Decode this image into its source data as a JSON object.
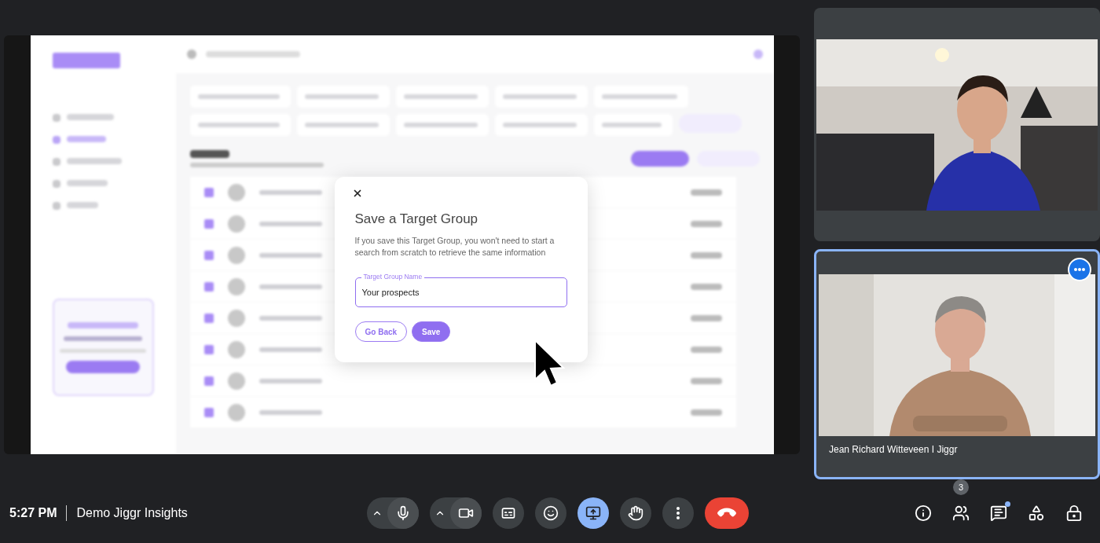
{
  "meeting": {
    "time": "5:27 PM",
    "title": "Demo Jiggr Insights"
  },
  "shared_screen": {
    "dialog": {
      "title": "Save a Target Group",
      "description": "If you save this Target Group, you won't need to start a search from scratch to retrieve the same information",
      "field": {
        "label": "Target Group Name",
        "value": "Your prospects"
      },
      "buttons": [
        {
          "label": "Go Back",
          "kind": "outline"
        },
        {
          "label": "Save",
          "kind": "primary"
        }
      ]
    }
  },
  "participants": [
    {
      "kind": "picture",
      "active": false
    },
    {
      "kind": "picture",
      "active": true,
      "name": "Jean Richard Witteveen I Jiggr"
    }
  ],
  "controls": [
    {
      "kind": "mic",
      "with_caret": true,
      "active": false
    },
    {
      "kind": "camera",
      "with_caret": true,
      "active": false
    },
    {
      "kind": "captions",
      "with_caret": false,
      "active": false
    },
    {
      "kind": "emoji",
      "with_caret": false,
      "active": false
    },
    {
      "kind": "present",
      "with_caret": false,
      "active": true
    },
    {
      "kind": "hand",
      "with_caret": false,
      "active": false
    },
    {
      "kind": "more",
      "with_caret": false,
      "active": false
    },
    {
      "kind": "leave",
      "with_caret": false,
      "active": false
    }
  ],
  "side_buttons": [
    {
      "kind": "info",
      "notification": false
    },
    {
      "kind": "people",
      "badge": "3",
      "notification": false
    },
    {
      "kind": "chat",
      "notification": true
    },
    {
      "kind": "activities",
      "notification": false
    },
    {
      "kind": "host",
      "notification": false
    }
  ]
}
